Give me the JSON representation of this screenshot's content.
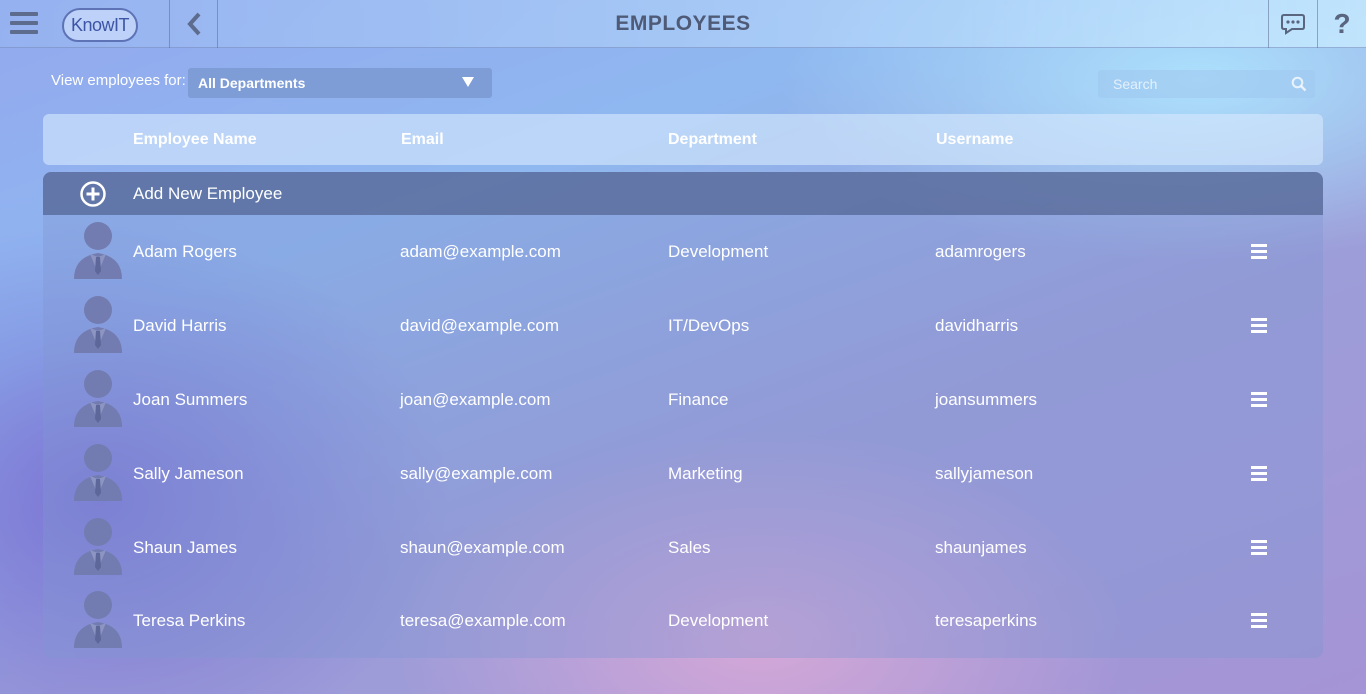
{
  "header": {
    "logo_text": "KnowIT",
    "title": "EMPLOYEES",
    "help_label": "?"
  },
  "filter": {
    "label": "View employees for:",
    "selected_department": "All Departments",
    "search_placeholder": "Search"
  },
  "table": {
    "columns": [
      "Employee Name",
      "Email",
      "Department",
      "Username"
    ],
    "add_label": "Add New Employee",
    "rows": [
      {
        "name": "Adam Rogers",
        "email": "adam@example.com",
        "department": "Development",
        "username": "adamrogers"
      },
      {
        "name": "David Harris",
        "email": "david@example.com",
        "department": "IT/DevOps",
        "username": "davidharris"
      },
      {
        "name": "Joan Summers",
        "email": "joan@example.com",
        "department": "Finance",
        "username": "joansummers"
      },
      {
        "name": "Sally Jameson",
        "email": "sally@example.com",
        "department": "Marketing",
        "username": "sallyjameson"
      },
      {
        "name": "Shaun James",
        "email": "shaun@example.com",
        "department": "Sales",
        "username": "shaunjames"
      },
      {
        "name": "Teresa Perkins",
        "email": "teresa@example.com",
        "department": "Development",
        "username": "teresaperkins"
      }
    ]
  },
  "icons": {
    "menu": "hamburger-icon",
    "back": "chevron-left-icon",
    "chat": "chat-bubble-icon",
    "help": "question-mark-icon",
    "search": "magnifier-icon",
    "add": "plus-circle-icon",
    "avatar": "person-avatar-icon",
    "row_menu": "hamburger-icon"
  },
  "colors": {
    "header_text": "#4f5a76",
    "add_row_bg": "#52648f",
    "text": "#ffffff"
  }
}
